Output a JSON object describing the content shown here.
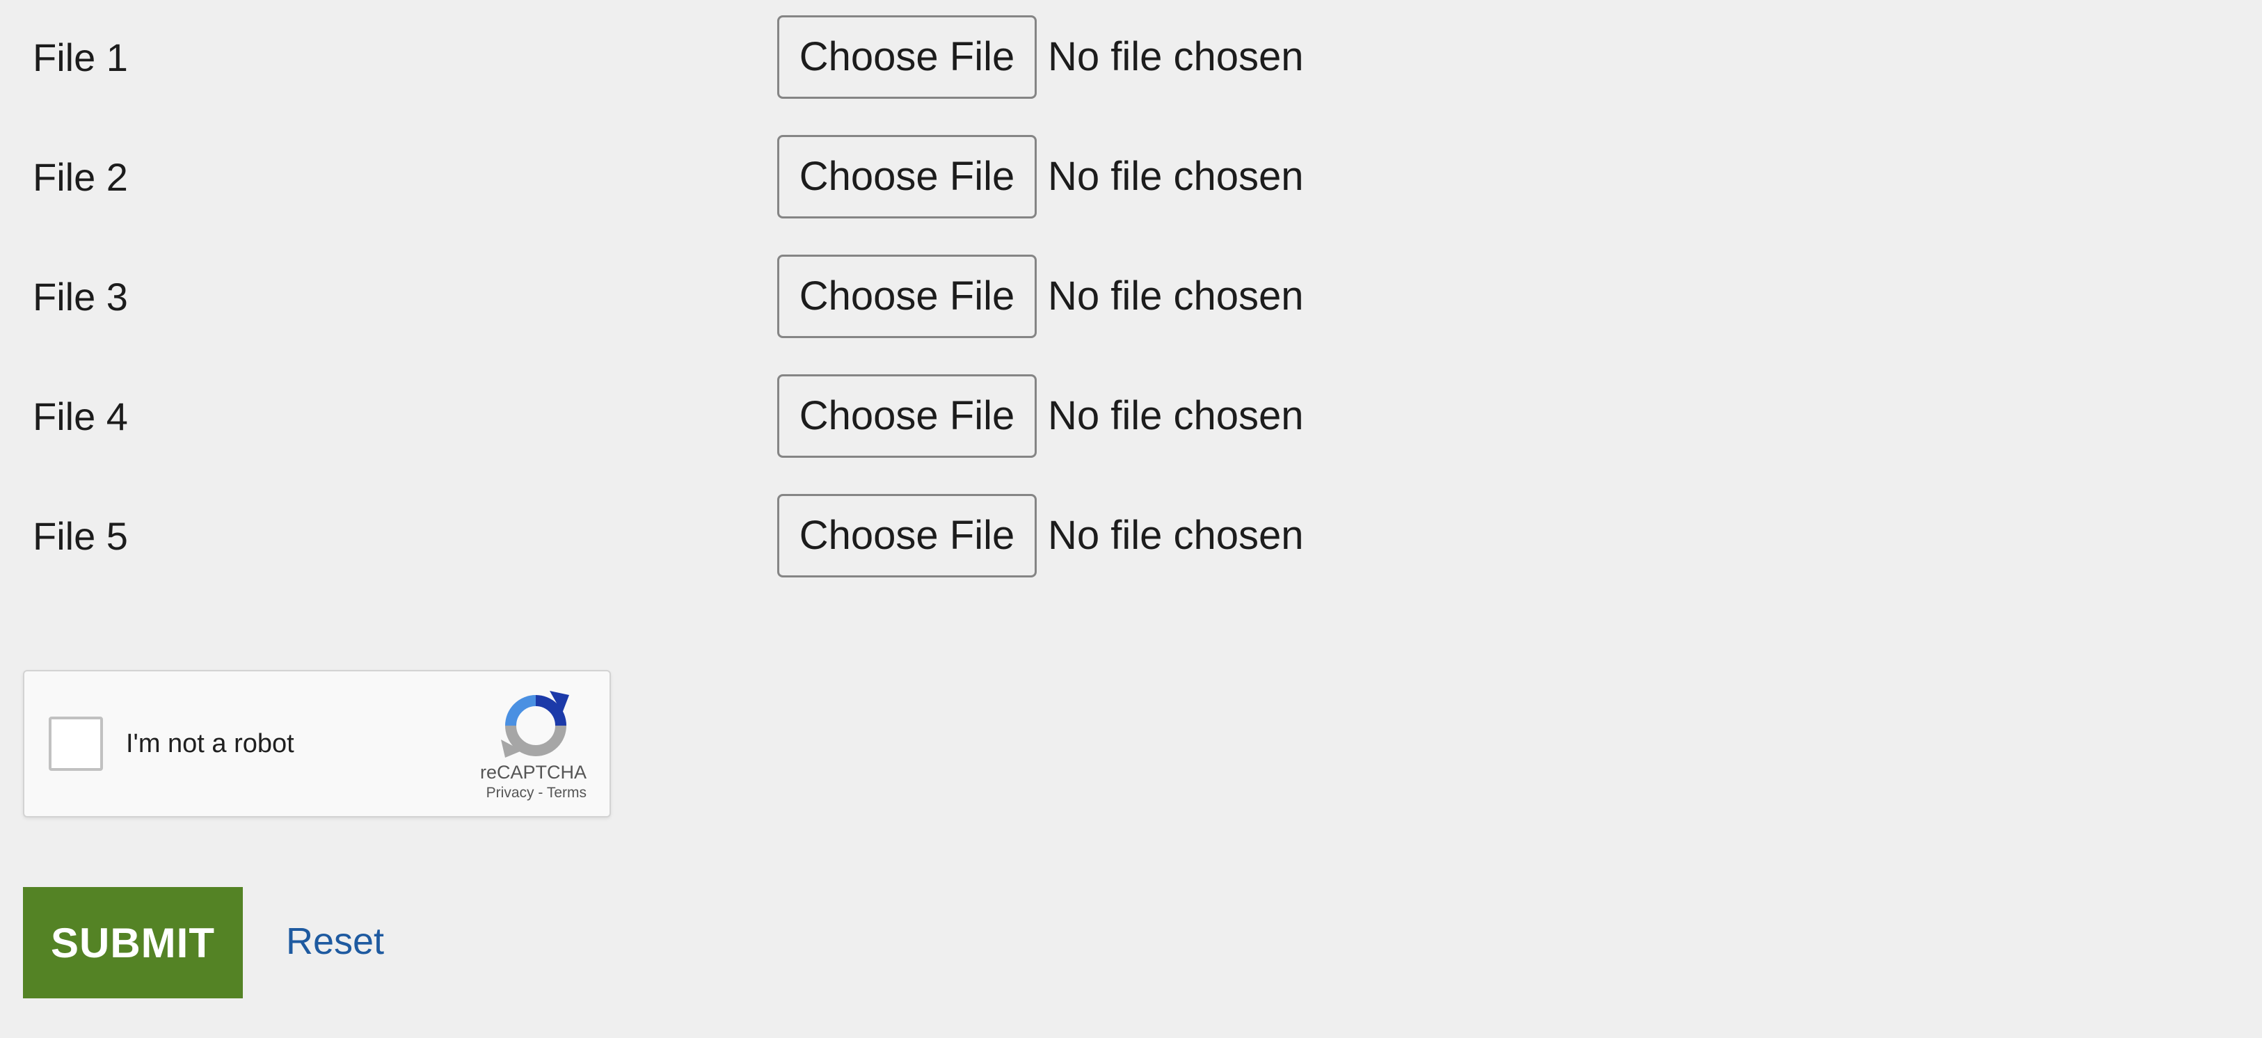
{
  "files": [
    {
      "label": "File 1",
      "button_label": "Choose File",
      "status": "No file chosen"
    },
    {
      "label": "File 2",
      "button_label": "Choose File",
      "status": "No file chosen"
    },
    {
      "label": "File 3",
      "button_label": "Choose File",
      "status": "No file chosen"
    },
    {
      "label": "File 4",
      "button_label": "Choose File",
      "status": "No file chosen"
    },
    {
      "label": "File 5",
      "button_label": "Choose File",
      "status": "No file chosen"
    }
  ],
  "recaptcha": {
    "label": "I'm not a robot",
    "brand": "reCAPTCHA",
    "privacy": "Privacy",
    "separator": " - ",
    "terms": "Terms",
    "icon": "recaptcha-logo-icon",
    "checked": false
  },
  "actions": {
    "submit_label": "SUBMIT",
    "reset_label": "Reset"
  },
  "colors": {
    "background": "#efefef",
    "submit": "#548325",
    "reset_link": "#1e5aa0"
  }
}
